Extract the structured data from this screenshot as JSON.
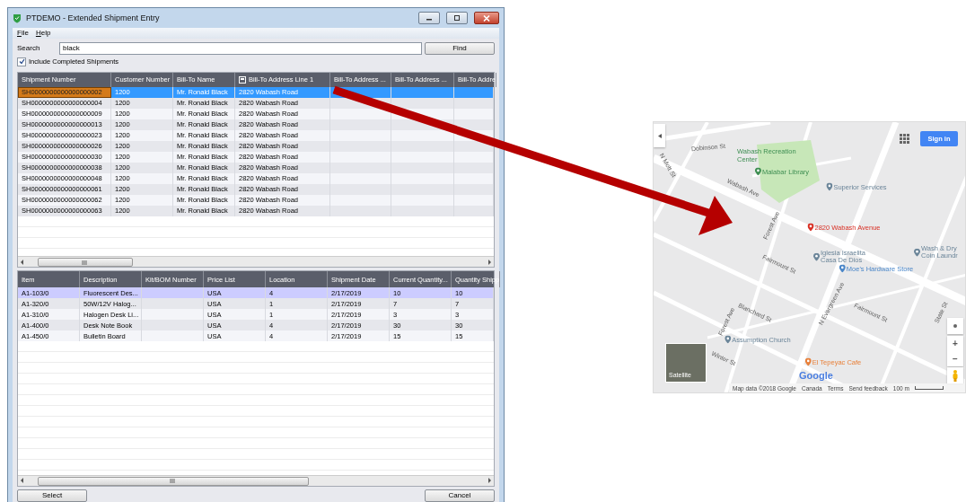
{
  "window": {
    "title": "PTDEMO - Extended Shipment Entry",
    "menu": [
      "File",
      "Help"
    ],
    "search": {
      "label": "Search",
      "value": "black"
    },
    "find_button": "Find",
    "include_completed": {
      "label": "Include Completed Shipments",
      "checked": true
    },
    "shipments": {
      "columns": [
        {
          "label": "Shipment Number",
          "has_icon": false
        },
        {
          "label": "Customer Number",
          "has_icon": false
        },
        {
          "label": "Bill-To Name",
          "has_icon": false
        },
        {
          "label": "Bill-To Address Line 1",
          "has_icon": true
        },
        {
          "label": "Bill-To Address ...",
          "has_icon": false
        },
        {
          "label": "Bill-To Address ...",
          "has_icon": false
        },
        {
          "label": "Bill-To Addre",
          "has_icon": false
        }
      ],
      "rows": [
        {
          "cells": [
            "SH0000000000000000002",
            "1200",
            "Mr. Ronald Black",
            "2820 Wabash Road"
          ],
          "selected": true
        },
        {
          "cells": [
            "SH0000000000000000004",
            "1200",
            "Mr. Ronald Black",
            "2820 Wabash Road"
          ],
          "selected": false
        },
        {
          "cells": [
            "SH0000000000000000009",
            "1200",
            "Mr. Ronald Black",
            "2820 Wabash Road"
          ],
          "selected": false
        },
        {
          "cells": [
            "SH0000000000000000013",
            "1200",
            "Mr. Ronald Black",
            "2820 Wabash Road"
          ],
          "selected": false
        },
        {
          "cells": [
            "SH0000000000000000023",
            "1200",
            "Mr. Ronald Black",
            "2820 Wabash Road"
          ],
          "selected": false
        },
        {
          "cells": [
            "SH0000000000000000026",
            "1200",
            "Mr. Ronald Black",
            "2820 Wabash Road"
          ],
          "selected": false
        },
        {
          "cells": [
            "SH0000000000000000030",
            "1200",
            "Mr. Ronald Black",
            "2820 Wabash Road"
          ],
          "selected": false
        },
        {
          "cells": [
            "SH0000000000000000038",
            "1200",
            "Mr. Ronald Black",
            "2820 Wabash Road"
          ],
          "selected": false
        },
        {
          "cells": [
            "SH0000000000000000048",
            "1200",
            "Mr. Ronald Black",
            "2820 Wabash Road"
          ],
          "selected": false
        },
        {
          "cells": [
            "SH0000000000000000061",
            "1200",
            "Mr. Ronald Black",
            "2820 Wabash Road"
          ],
          "selected": false
        },
        {
          "cells": [
            "SH0000000000000000062",
            "1200",
            "Mr. Ronald Black",
            "2820 Wabash Road"
          ],
          "selected": false
        },
        {
          "cells": [
            "SH0000000000000000063",
            "1200",
            "Mr. Ronald Black",
            "2820 Wabash Road"
          ],
          "selected": false
        }
      ]
    },
    "items": {
      "columns": [
        {
          "label": "Item",
          "has_icon": false
        },
        {
          "label": "Description",
          "has_icon": false
        },
        {
          "label": "Kit/BOM Number",
          "has_icon": false
        },
        {
          "label": "Price List",
          "has_icon": false
        },
        {
          "label": "Location",
          "has_icon": false
        },
        {
          "label": "Shipment Date",
          "has_icon": false
        },
        {
          "label": "Current Quantity...",
          "has_icon": false
        },
        {
          "label": "Quantity Shipp",
          "has_icon": false
        }
      ],
      "rows": [
        {
          "cells": [
            "A1-103/0",
            "Fluorescent Des...",
            "",
            "USA",
            "4",
            "2/17/2019",
            "10",
            "10"
          ],
          "selected": true
        },
        {
          "cells": [
            "A1-320/0",
            "50W/12V Halog...",
            "",
            "USA",
            "1",
            "2/17/2019",
            "7",
            "7"
          ],
          "selected": false
        },
        {
          "cells": [
            "A1-310/0",
            "Halogen Desk Li...",
            "",
            "USA",
            "1",
            "2/17/2019",
            "3",
            "3"
          ],
          "selected": false
        },
        {
          "cells": [
            "A1-400/0",
            "Desk Note Book",
            "",
            "USA",
            "4",
            "2/17/2019",
            "30",
            "30"
          ],
          "selected": false
        },
        {
          "cells": [
            "A1-450/0",
            "Bulletin Board",
            "",
            "USA",
            "4",
            "2/17/2019",
            "15",
            "15"
          ],
          "selected": false
        }
      ]
    },
    "buttons": [
      "Select",
      "Cancel"
    ]
  },
  "map": {
    "sign_in": "Sign in",
    "labels": [
      {
        "text": "Dobinson St",
        "kind": "street"
      },
      {
        "text": "Wabash Recreation Center",
        "kind": "area"
      },
      {
        "text": "Malabar Library",
        "kind": "place",
        "color": "#3e8e52"
      },
      {
        "text": "Wabash Ave",
        "kind": "street"
      },
      {
        "text": "Superior Services",
        "kind": "place",
        "color": "#6b8599"
      },
      {
        "text": "2820 Wabash Avenue",
        "kind": "place",
        "color": "#d93025"
      },
      {
        "text": "Iglesia Israelita Casa De Dios",
        "kind": "place",
        "color": "#6b8599"
      },
      {
        "text": "Wash & Dry Coin Laundr",
        "kind": "place",
        "color": "#6b8599"
      },
      {
        "text": "Moe's Hardware Store",
        "kind": "place",
        "color": "#4a86c8"
      },
      {
        "text": "Assumption Church",
        "kind": "place",
        "color": "#6b8599"
      },
      {
        "text": "El Tepeyac Cafe",
        "kind": "place",
        "color": "#e8803a"
      },
      {
        "text": "N Mott St",
        "kind": "street"
      },
      {
        "text": "Forest Ave",
        "kind": "street"
      },
      {
        "text": "N Evergreen Ave",
        "kind": "street"
      },
      {
        "text": "Fairmount St",
        "kind": "street"
      },
      {
        "text": "Fairmount St",
        "kind": "street"
      },
      {
        "text": "Blanchard St",
        "kind": "street"
      },
      {
        "text": "Forest Ave",
        "kind": "street"
      },
      {
        "text": "Winter St",
        "kind": "street"
      },
      {
        "text": "State St",
        "kind": "street"
      }
    ],
    "zoom_in": "+",
    "zoom_out": "−",
    "satellite": "Satellite",
    "logo": "Google",
    "footer": [
      "Map data ©2018 Google",
      "Canada",
      "Terms",
      "Send feedback",
      "100 m"
    ]
  }
}
